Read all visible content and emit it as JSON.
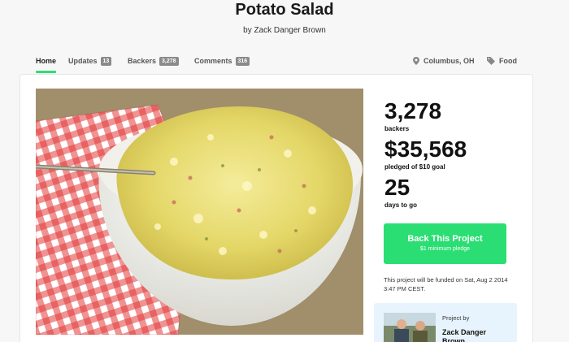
{
  "project": {
    "title": "Potato Salad",
    "byline": "by Zack Danger Brown"
  },
  "nav": {
    "tabs": [
      {
        "label": "Home",
        "count": null
      },
      {
        "label": "Updates",
        "count": "13"
      },
      {
        "label": "Backers",
        "count": "3,278"
      },
      {
        "label": "Comments",
        "count": "316"
      }
    ],
    "location": "Columbus, OH",
    "category": "Food"
  },
  "stats": {
    "backers_value": "3,278",
    "backers_label": "backers",
    "pledged_value": "$35,568",
    "pledged_label": "pledged of $10 goal",
    "days_value": "25",
    "days_label": "days to go"
  },
  "cta": {
    "label": "Back This Project",
    "sublabel": "$1 minimum pledge"
  },
  "funding_note": "This project will be funded on Sat, Aug 2 2014 3:47 PM CEST.",
  "creator": {
    "project_by_label": "Project by",
    "name": "Zack Danger Brown"
  },
  "colors": {
    "accent": "#2bde73",
    "badge": "#8a8a8a",
    "creator_bg": "#e8f4fd"
  },
  "icons": {
    "location": "map-pin-icon",
    "category": "tag-icon"
  }
}
